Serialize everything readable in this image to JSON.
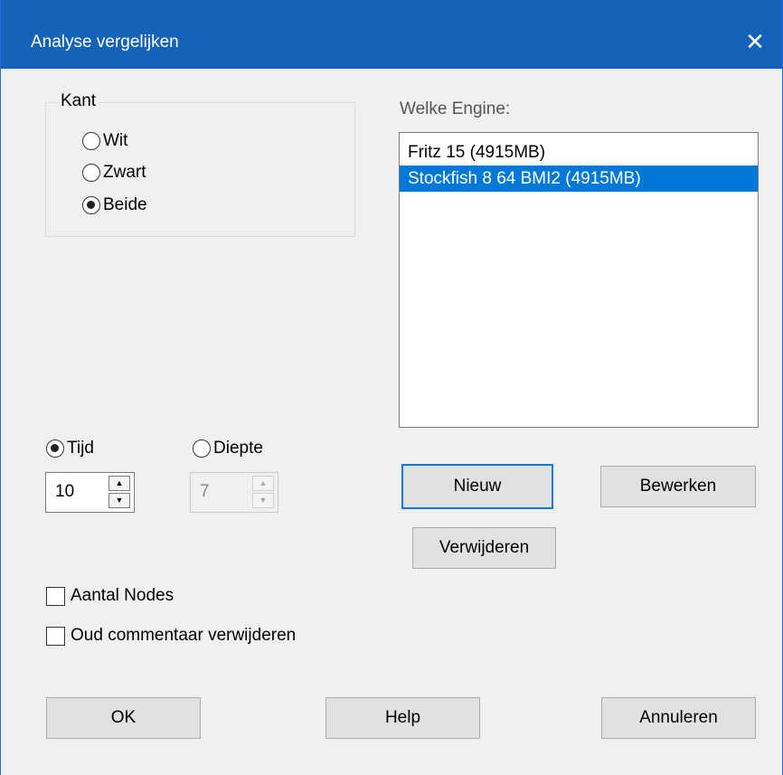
{
  "window": {
    "title": "Analyse vergelijken",
    "close_glyph": "✕"
  },
  "kant": {
    "legend": "Kant",
    "options": [
      {
        "label": "Wit",
        "checked": false
      },
      {
        "label": "Zwart",
        "checked": false
      },
      {
        "label": "Beide",
        "checked": true
      }
    ]
  },
  "engine": {
    "label": "Welke Engine:",
    "items": [
      {
        "label": "Fritz 15 (4915MB)",
        "selected": false
      },
      {
        "label": "Stockfish 8 64 BMI2 (4915MB)",
        "selected": true
      }
    ]
  },
  "mode": {
    "tijd": {
      "label": "Tijd",
      "checked": true,
      "value": "10"
    },
    "diepte": {
      "label": "Diepte",
      "checked": false,
      "value": "7"
    }
  },
  "buttons": {
    "nieuw": "Nieuw",
    "bewerken": "Bewerken",
    "verwijderen": "Verwijderen",
    "ok": "OK",
    "help": "Help",
    "annuleren": "Annuleren"
  },
  "checks": {
    "aantal_nodes": {
      "label": "Aantal Nodes",
      "checked": false
    },
    "oud_commentaar": {
      "label": "Oud commentaar verwijderen",
      "checked": false
    }
  },
  "spin_arrows": {
    "up": "▲",
    "down": "▼"
  },
  "colors": {
    "titlebar": "#1563b9",
    "selection": "#0078d7",
    "dialog_bg": "#f0f0f0"
  }
}
